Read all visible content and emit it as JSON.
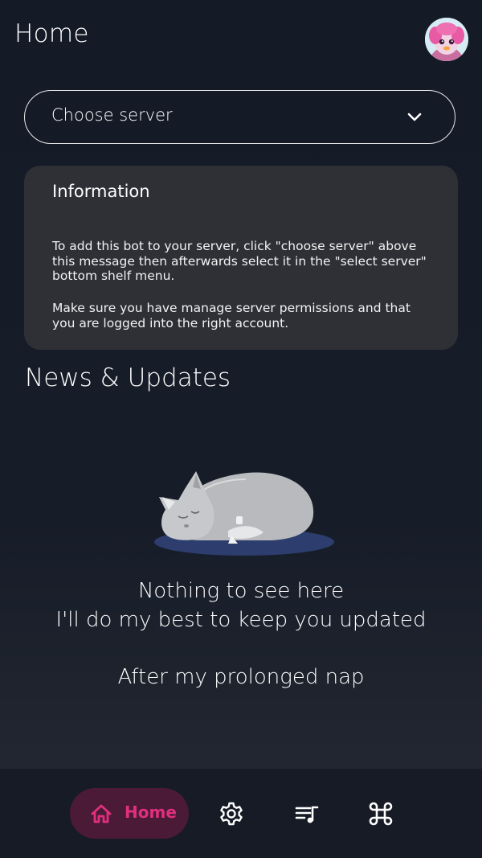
{
  "header": {
    "title": "Home",
    "avatar_icon": "user-avatar-icon"
  },
  "server_select": {
    "label": "Choose server",
    "icon": "chevron-down-icon"
  },
  "info_card": {
    "title": "Information",
    "paragraph_1": "To add this bot to your server, click \"choose server\" above this message then afterwards select it in the \"select server\" bottom shelf menu.",
    "paragraph_2": "Make sure you have manage server permissions and that you are logged into the right account."
  },
  "news": {
    "title": "News & Updates",
    "illustration_icon": "sleeping-cat-icon",
    "empty_line_1": "Nothing to see here",
    "empty_line_2": "I'll do my best to keep you updated",
    "empty_line_3": "After my prolonged nap"
  },
  "bottom_nav": {
    "home_label": "Home",
    "home_icon": "home-icon",
    "settings_icon": "gear-icon",
    "queue_icon": "music-queue-icon",
    "commands_icon": "command-icon"
  },
  "colors": {
    "background": "#141a26",
    "card": "#2e3036",
    "accent": "#e0307d",
    "accent_pill": "#4a1a37",
    "nav_bar": "#161b26"
  }
}
